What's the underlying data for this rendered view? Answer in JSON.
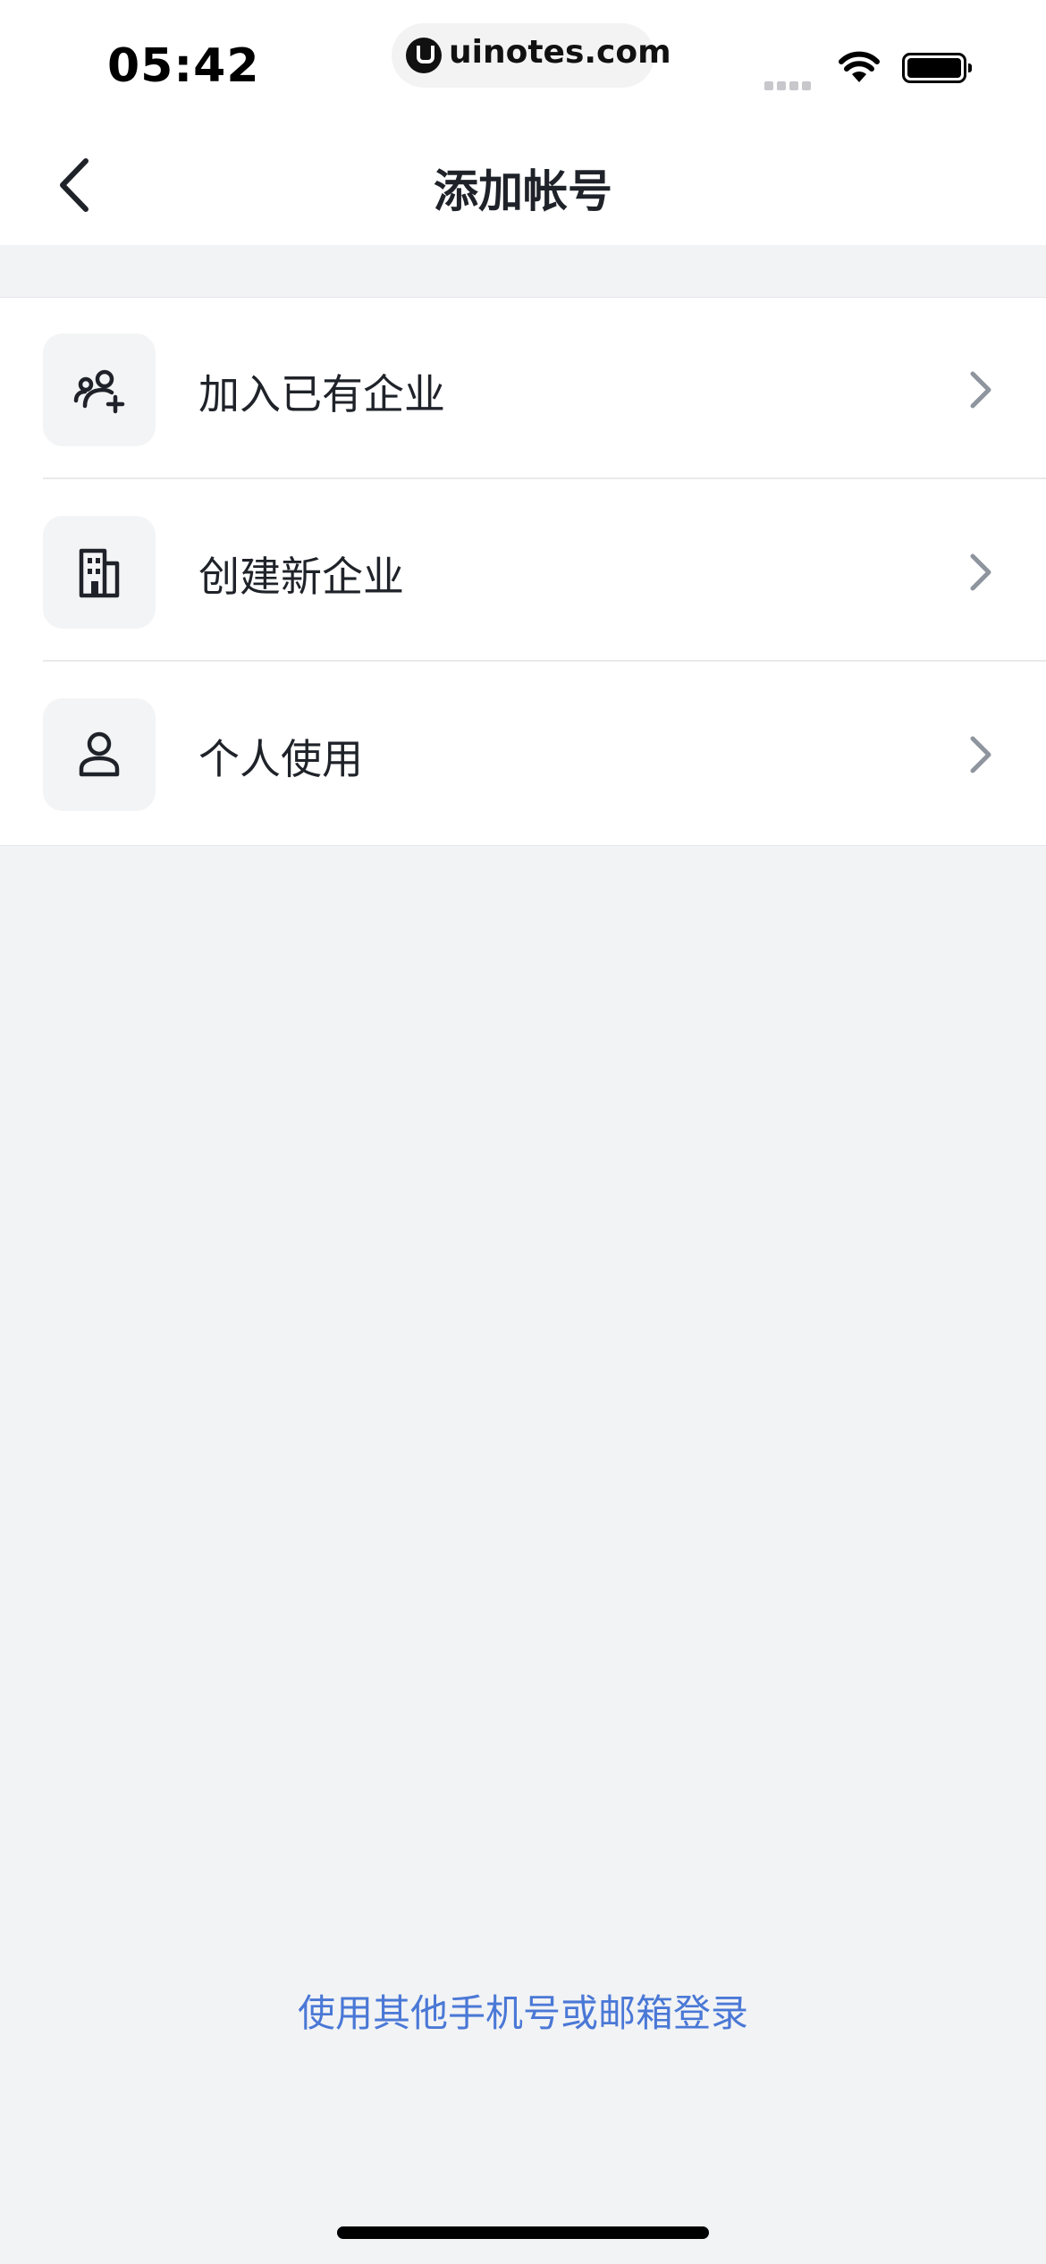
{
  "status_bar": {
    "time": "05:42",
    "url": "uinotes.com",
    "icons": [
      "signal-icon",
      "wifi-icon",
      "battery-icon"
    ]
  },
  "nav": {
    "title": "添加帐号",
    "back_icon": "chevron-left-icon"
  },
  "menu": {
    "items": [
      {
        "label": "加入已有企业",
        "icon": "users-add-icon"
      },
      {
        "label": "创建新企业",
        "icon": "building-icon"
      },
      {
        "label": "个人使用",
        "icon": "person-icon"
      }
    ],
    "chevron_icon": "chevron-right-icon"
  },
  "footer": {
    "alt_login": "使用其他手机号或邮箱登录"
  },
  "colors": {
    "background": "#f2f3f5",
    "link": "#4a78d6",
    "text": "#1f2329"
  }
}
